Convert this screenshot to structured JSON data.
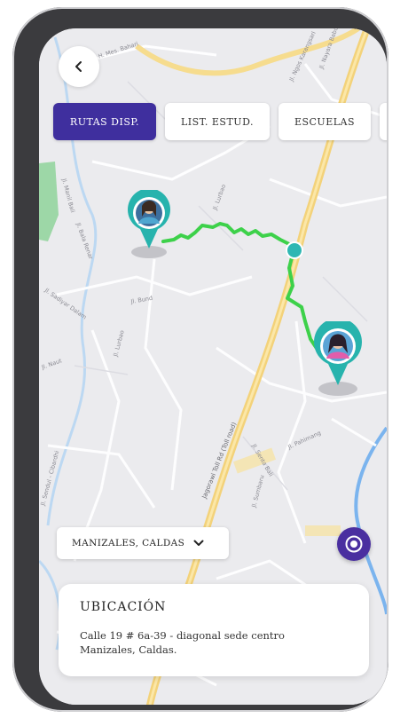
{
  "header": {
    "back_label": "‹"
  },
  "tabs": [
    {
      "label": "RUTAS DISP.",
      "active": true
    },
    {
      "label": "LIST. ESTUD.",
      "active": false
    },
    {
      "label": "ESCUELAS",
      "active": false
    },
    {
      "label": "",
      "active": false
    }
  ],
  "map": {
    "street_labels": [
      "Jl. H. Mes. Bahari",
      "Jl. Ngos Karangsari",
      "Jl. Nayara Babon",
      "Jl. Lurbao",
      "Jl. Manil Bali",
      "Jl. Bala Renar",
      "Jl. Bund",
      "Jl. Lurbao",
      "Jl. Naut",
      "Jl. Sadiyar Dalam",
      "Jl. Sendul - Cibardhi",
      "Jl. Pahimang",
      "Jl. Senta Bali",
      "Jl. Sumbaru",
      "Jagorawi Toll Rd (Toll road)"
    ],
    "route_color": "#3dd14a",
    "pin_color": "#27b3ad"
  },
  "location_select": {
    "label": "MANIZALES, CALDAS",
    "icon": "chevron-down-icon"
  },
  "locate_button": {
    "icon": "target-icon",
    "color": "#4a2fa0"
  },
  "info_card": {
    "title": "UBICACIÓN",
    "address_line1": "Calle 19 # 6a-39 - diagonal sede centro",
    "address_line2": "Manizales, Caldas."
  }
}
